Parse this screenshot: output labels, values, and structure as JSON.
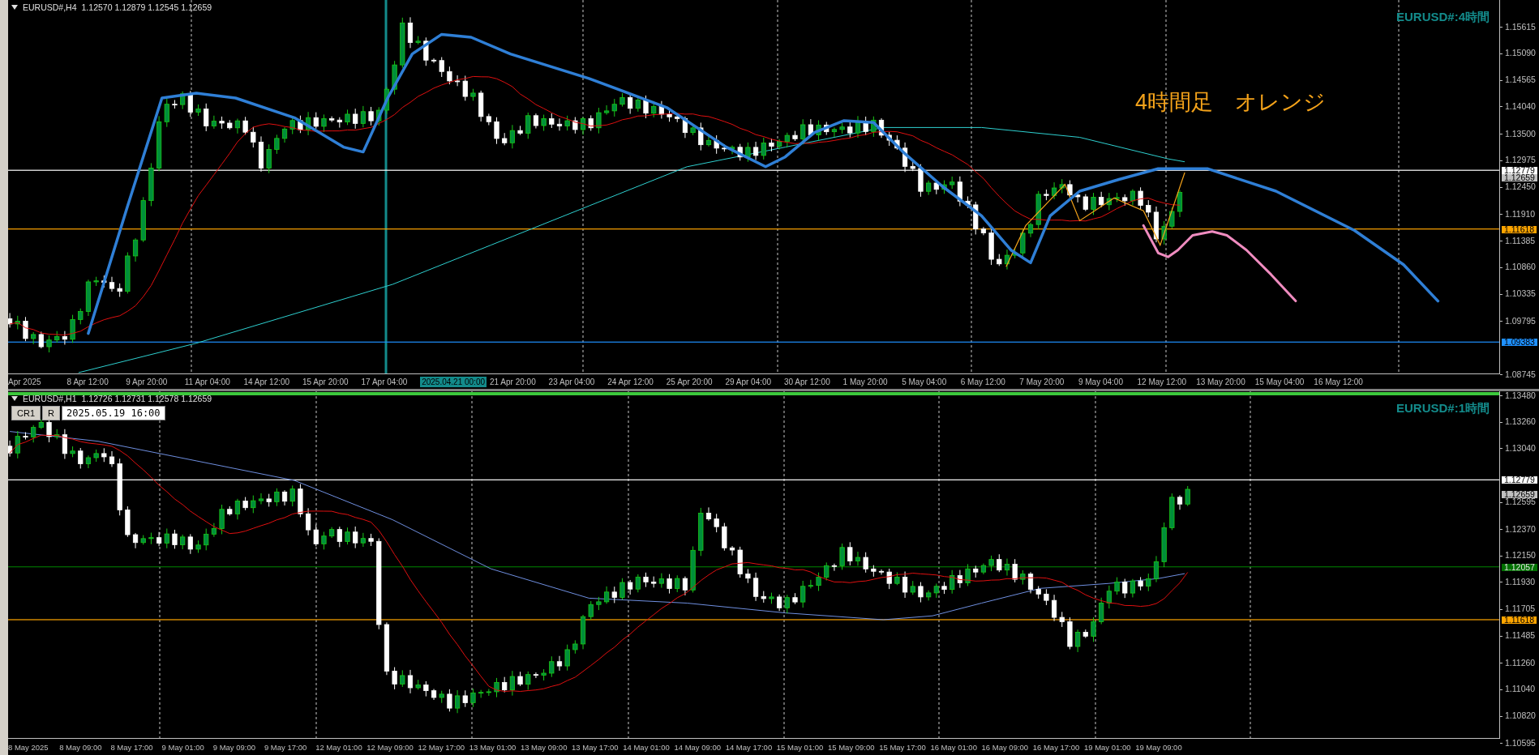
{
  "upper_chart": {
    "header": {
      "symbol": "EURUSD#,H4",
      "ohlc": "1.12570 1.12879 1.12545 1.12659"
    },
    "label": "EURUSD#:4時間",
    "annotation": "4時間足　オレンジ",
    "price_axis": [
      "1.15615",
      "1.15090",
      "1.14565",
      "1.14040",
      "1.13500",
      "1.12975",
      "1.12450",
      "1.11910",
      "1.11385",
      "1.10860",
      "1.10335",
      "1.09795",
      "1.08745"
    ],
    "price_tags": [
      {
        "value": "1.12779",
        "color": "#ffffff",
        "line": true
      },
      {
        "value": "1.12659",
        "color": "#c0c0c0",
        "line": false
      },
      {
        "value": "1.11618",
        "color": "#ffa500",
        "line": true
      },
      {
        "value": "1.09383",
        "color": "#1e90ff",
        "line": true
      }
    ],
    "time_axis": [
      {
        "label": "Apr 2025",
        "selected": false
      },
      {
        "label": "8 Apr 12:00",
        "selected": false
      },
      {
        "label": "9 Apr 20:00",
        "selected": false
      },
      {
        "label": "11 Apr 04:00",
        "selected": false
      },
      {
        "label": "14 Apr 12:00",
        "selected": false
      },
      {
        "label": "15 Apr 20:00",
        "selected": false
      },
      {
        "label": "17 Apr 04:00",
        "selected": false
      },
      {
        "label": "2025.04.21 00:00",
        "selected": true
      },
      {
        "label": "21 Apr 20:00",
        "selected": false
      },
      {
        "label": "23 Apr 04:00",
        "selected": false
      },
      {
        "label": "24 Apr 12:00",
        "selected": false
      },
      {
        "label": "25 Apr 20:00",
        "selected": false
      },
      {
        "label": "29 Apr 04:00",
        "selected": false
      },
      {
        "label": "30 Apr 12:00",
        "selected": false
      },
      {
        "label": "1 May 20:00",
        "selected": false
      },
      {
        "label": "5 May 04:00",
        "selected": false
      },
      {
        "label": "6 May 12:00",
        "selected": false
      },
      {
        "label": "7 May 20:00",
        "selected": false
      },
      {
        "label": "9 May 04:00",
        "selected": false
      },
      {
        "label": "12 May 12:00",
        "selected": false
      },
      {
        "label": "13 May 20:00",
        "selected": false
      },
      {
        "label": "15 May 04:00",
        "selected": false
      },
      {
        "label": "16 May 12:00",
        "selected": false
      }
    ]
  },
  "lower_chart": {
    "header": {
      "symbol": "EURUSD#,H1",
      "ohlc": "1.12726 1.12731 1.12578 1.12659"
    },
    "buttons": [
      "CR1",
      "R"
    ],
    "crosshair_time": "2025.05.19 16:00",
    "label": "EURUSD#:1時間",
    "price_axis": [
      "1.13480",
      "1.13260",
      "1.13040",
      "1.12595",
      "1.12370",
      "1.12150",
      "1.11930",
      "1.11705",
      "1.11485",
      "1.11260",
      "1.11040",
      "1.10820",
      "1.10595"
    ],
    "price_tags": [
      {
        "value": "1.12779",
        "color": "#ffffff",
        "line": true
      },
      {
        "value": "1.12659",
        "color": "#c0c0c0",
        "line": false
      },
      {
        "value": "1.12057",
        "color": "#007000",
        "line": true
      },
      {
        "value": "1.11618",
        "color": "#ffa500",
        "line": true
      }
    ],
    "time_axis": [
      {
        "label": "8 May 2025",
        "selected": false
      },
      {
        "label": "8 May 09:00",
        "selected": false
      },
      {
        "label": "8 May 17:00",
        "selected": false
      },
      {
        "label": "9 May 01:00",
        "selected": false
      },
      {
        "label": "9 May 09:00",
        "selected": false
      },
      {
        "label": "9 May 17:00",
        "selected": false
      },
      {
        "label": "12 May 01:00",
        "selected": false
      },
      {
        "label": "12 May 09:00",
        "selected": false
      },
      {
        "label": "12 May 17:00",
        "selected": false
      },
      {
        "label": "13 May 01:00",
        "selected": false
      },
      {
        "label": "13 May 09:00",
        "selected": false
      },
      {
        "label": "13 May 17:00",
        "selected": false
      },
      {
        "label": "14 May 01:00",
        "selected": false
      },
      {
        "label": "14 May 09:00",
        "selected": false
      },
      {
        "label": "14 May 17:00",
        "selected": false
      },
      {
        "label": "15 May 01:00",
        "selected": false
      },
      {
        "label": "15 May 09:00",
        "selected": false
      },
      {
        "label": "15 May 17:00",
        "selected": false
      },
      {
        "label": "16 May 01:00",
        "selected": false
      },
      {
        "label": "16 May 09:00",
        "selected": false
      },
      {
        "label": "16 May 17:00",
        "selected": false
      },
      {
        "label": "19 May 01:00",
        "selected": false
      },
      {
        "label": "19 May 09:00",
        "selected": false
      }
    ]
  }
}
